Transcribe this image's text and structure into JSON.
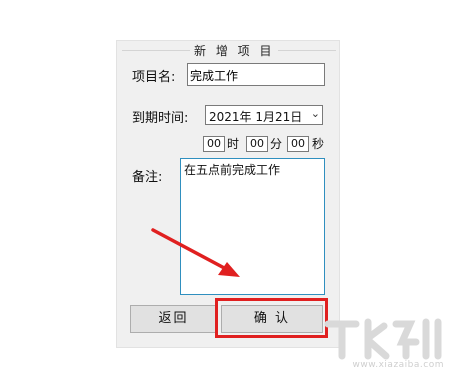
{
  "dialog": {
    "group_title": "新 增 项 目",
    "project_name": {
      "label": "项目名:",
      "value": "完成工作"
    },
    "due_time": {
      "label": "到期时间:",
      "date_value": "2021年 1月21日",
      "hour_value": "00",
      "hour_unit": "时",
      "minute_value": "00",
      "minute_unit": "分",
      "second_value": "00",
      "second_unit": "秒"
    },
    "notes": {
      "label": "备注:",
      "value": "在五点前完成工作"
    },
    "buttons": {
      "back": "返回",
      "confirm": "确 认"
    }
  },
  "overlay": {
    "highlight_color": "#e02020",
    "arrow_color": "#e02020",
    "watermark_url": "www.xiazaiba.com"
  }
}
